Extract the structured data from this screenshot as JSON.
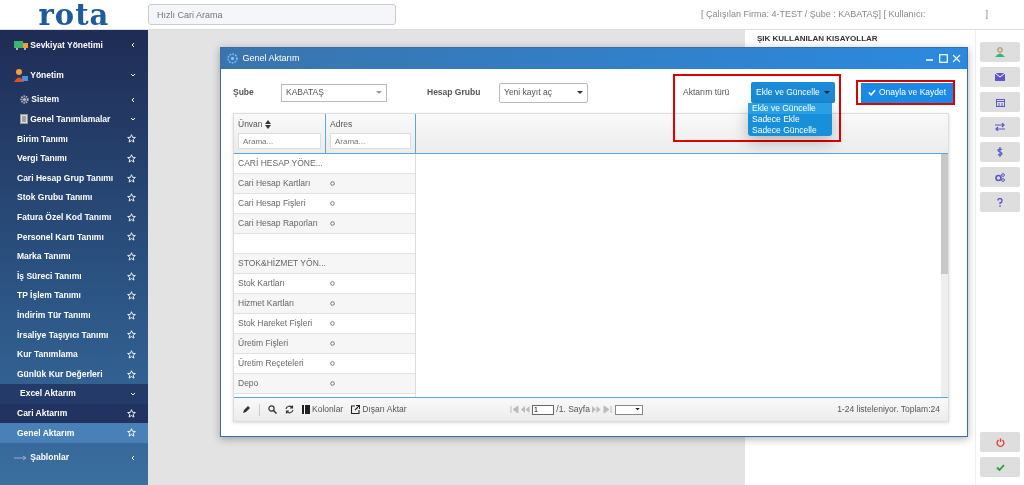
{
  "header": {
    "logo": "rota",
    "search": {
      "placeholder": "Hızlı Cari Arama"
    },
    "info": "[ Çalışılan Firma: 4-TEST / Şube : KABATAŞ] [ Kullanıcı:",
    "info_end": "]"
  },
  "sidebar": {
    "items": [
      {
        "kind": "section",
        "label": "Sevkiyat Yönetimi",
        "expanded": false
      },
      {
        "kind": "section",
        "label": "Yönetim",
        "expanded": true
      },
      {
        "kind": "sub",
        "label": "Sistem",
        "expanded": false
      },
      {
        "kind": "sub",
        "label": "Genel Tanımlamalar",
        "expanded": true
      },
      {
        "kind": "item",
        "label": "Birim Tanımı",
        "selected": false
      },
      {
        "kind": "item",
        "label": "Vergi Tanımı",
        "selected": false
      },
      {
        "kind": "item",
        "label": "Cari Hesap Grup Tanımı",
        "selected": false
      },
      {
        "kind": "item",
        "label": "Stok Grubu Tanımı",
        "selected": false
      },
      {
        "kind": "item",
        "label": "Fatura Özel Kod Tanımı",
        "selected": false
      },
      {
        "kind": "item",
        "label": "Personel Kartı Tanımı",
        "selected": false
      },
      {
        "kind": "item",
        "label": "Marka Tanımı",
        "selected": false
      },
      {
        "kind": "item",
        "label": "İş Süreci Tanımı",
        "selected": false
      },
      {
        "kind": "item",
        "label": "TP İşlem Tanımı",
        "selected": false
      },
      {
        "kind": "item",
        "label": "İndirim Tür Tanımı",
        "selected": false
      },
      {
        "kind": "item",
        "label": "İrsaliye Taşıyıcı Tanımı",
        "selected": false
      },
      {
        "kind": "item",
        "label": "Kur Tanımlama",
        "selected": false
      },
      {
        "kind": "item",
        "label": "Günlük Kur Değerleri",
        "selected": false
      },
      {
        "kind": "group",
        "label": "Excel Aktarım",
        "expanded": true,
        "children": [
          {
            "label": "Cari Aktarım",
            "selected": false
          },
          {
            "label": "Genel Aktarım",
            "selected": true
          }
        ]
      },
      {
        "kind": "section",
        "label": "Şablonlar",
        "expanded": false
      }
    ]
  },
  "shortcuts": {
    "title": "ŞIK KULLANILAN KISAYOLLAR"
  },
  "dialog": {
    "title": "Genel Aktarım",
    "sube": {
      "label": "Şube",
      "value": "KABATAŞ"
    },
    "hesap_grubu": {
      "label": "Hesap Grubu",
      "value": "Yeni kayıt aç"
    },
    "aktarim_turu": {
      "label": "Aktarım türü",
      "value": "Ekle ve Güncelle",
      "highlighted": true,
      "options": [
        {
          "label": "Ekle ve Güncelle",
          "selected": true
        },
        {
          "label": "Sadece Ekle",
          "selected": false
        },
        {
          "label": "Sadece Güncelle",
          "selected": false
        }
      ]
    },
    "save_button": {
      "label": "Onayla ve Kaydet",
      "highlighted": true
    },
    "grid": {
      "columns": [
        {
          "title": "Ünvan",
          "sortable": true,
          "placeholder": "Arama..."
        },
        {
          "title": "Adres",
          "sortable": false,
          "placeholder": "Arama..."
        }
      ],
      "rows": [
        {
          "kind": "group",
          "title": "CARİ HESAP YÖNE..."
        },
        {
          "kind": "item",
          "title": "Cari Hesap Kartları"
        },
        {
          "kind": "item",
          "title": "Cari Hesap Fişleri"
        },
        {
          "kind": "item",
          "title": "Cari Hesap Raporları"
        },
        {
          "kind": "blank"
        },
        {
          "kind": "group",
          "title": "STOK&HİZMET YÖN..."
        },
        {
          "kind": "item",
          "title": "Stok Kartları"
        },
        {
          "kind": "item",
          "title": "Hizmet Kartları"
        },
        {
          "kind": "item",
          "title": "Stok Hareket Fişleri"
        },
        {
          "kind": "item",
          "title": "Üretim Fişleri"
        },
        {
          "kind": "item",
          "title": "Üretim Reçeteleri"
        },
        {
          "kind": "item",
          "title": "Depo"
        }
      ],
      "toolbar": {
        "columns": "Kolonlar",
        "export": "Dışarı Aktar"
      },
      "pager": {
        "page": "1",
        "pages": "/1. Sayfa"
      },
      "status": "1-24 listeleniyor. Toplam:24"
    }
  },
  "right_toolbar": [
    {
      "kind": "user"
    },
    {
      "kind": "mail"
    },
    {
      "kind": "calendar"
    },
    {
      "kind": "transfer"
    },
    {
      "kind": "dollar"
    },
    {
      "kind": "gears"
    },
    {
      "kind": "help"
    },
    {
      "kind": "power"
    },
    {
      "kind": "check"
    }
  ]
}
